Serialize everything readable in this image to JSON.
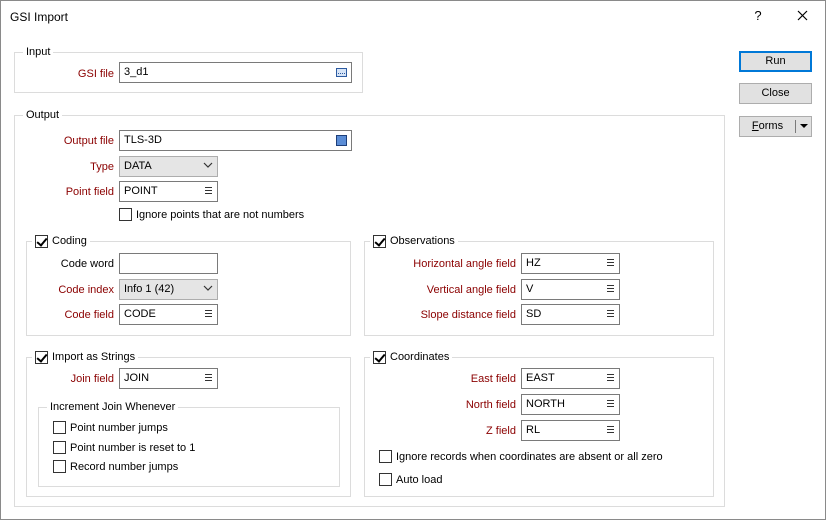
{
  "window": {
    "title": "GSI Import",
    "help": "?",
    "close_icon": "close-icon"
  },
  "buttons": {
    "run": "Run",
    "close": "Close",
    "forms": "Forms"
  },
  "input_group": {
    "label": "Input",
    "gsi_file_label": "GSI file",
    "gsi_file_value": "3_d1"
  },
  "output_group": {
    "label": "Output",
    "output_file_label": "Output file",
    "output_file_value": "TLS-3D",
    "type_label": "Type",
    "type_value": "DATA",
    "point_field_label": "Point field",
    "point_field_value": "POINT",
    "ignore_points_label": "Ignore points that are not numbers",
    "ignore_points_checked": false
  },
  "coding": {
    "label": "Coding",
    "checked": true,
    "code_word_label": "Code word",
    "code_word_value": "",
    "code_index_label": "Code index",
    "code_index_value": "Info 1 (42)",
    "code_field_label": "Code field",
    "code_field_value": "CODE"
  },
  "observations": {
    "label": "Observations",
    "checked": true,
    "hz_label": "Horizontal angle field",
    "hz_value": "HZ",
    "v_label": "Vertical angle field",
    "v_value": "V",
    "sd_label": "Slope distance field",
    "sd_value": "SD"
  },
  "strings": {
    "label": "Import as Strings",
    "checked": true,
    "join_label": "Join field",
    "join_value": "JOIN",
    "increment_label": "Increment Join Whenever",
    "point_jumps": "Point number jumps",
    "point_reset": "Point number is reset to 1",
    "record_jumps": "Record number jumps"
  },
  "coordinates": {
    "label": "Coordinates",
    "checked": true,
    "east_label": "East field",
    "east_value": "EAST",
    "north_label": "North field",
    "north_value": "NORTH",
    "z_label": "Z field",
    "z_value": "RL",
    "ignore_records_label": "Ignore records when coordinates are absent or all zero",
    "auto_load_label": "Auto load"
  }
}
